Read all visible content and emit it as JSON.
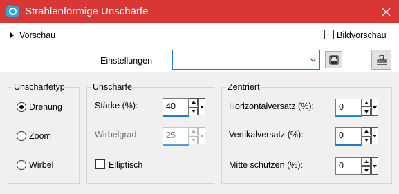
{
  "window": {
    "title": "Strahlenförmige Unschärfe",
    "icon": "camera-app-icon"
  },
  "preview": {
    "label": "Vorschau",
    "bild_label": "Bildvorschau",
    "bild_checked": false
  },
  "settings": {
    "label": "Einstellungen",
    "value": ""
  },
  "blur_type": {
    "title": "Unschärfetyp",
    "options": [
      "Drehung",
      "Zoom",
      "Wirbel"
    ],
    "selected": "Drehung"
  },
  "blur": {
    "title": "Unschärfe",
    "strength_label": "Stärke (%):",
    "strength_value": "40",
    "twist_label": "Wirbelgrad:",
    "twist_value": "25",
    "elliptical_label": "Elliptisch",
    "elliptical_checked": false
  },
  "centered": {
    "title": "Zentriert",
    "h_label": "Horizontalversatz (%):",
    "h_value": "0",
    "v_label": "Vertikalversatz (%):",
    "v_value": "0",
    "protect_label": "Mitte schützen (%):",
    "protect_value": "0"
  },
  "colors": {
    "titlebar": "#d93636",
    "accent": "#1e7bd4"
  }
}
